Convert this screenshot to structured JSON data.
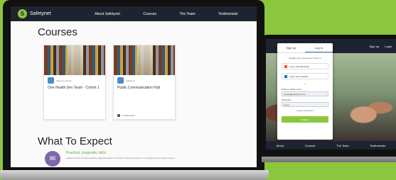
{
  "colors": {
    "background": "#8cc63f",
    "nav_bg": "#1d2330",
    "accent_green": "#8cc63f",
    "feature_purple": "#7b69a8",
    "link_blue": "#3a6fb0"
  },
  "laptop": {
    "nav": {
      "logo_text": "Safetynet",
      "links": [
        "About Safetynet",
        "Courses",
        "The Team",
        "Testimonials"
      ]
    },
    "courses_title": "Courses",
    "cards": [
      {
        "author": "Safetynet Admin",
        "title": "One Health Dev Team - Cohort 1",
        "footer": ""
      },
      {
        "author": "Safetynet",
        "title": "Public Communication Hub",
        "footer": "In Discussion"
      }
    ],
    "expect_title": "What To Expect",
    "feature": {
      "name": "Practical, pragmatic skills",
      "description": "Safetynet aims to build practical, pragmatic skills in the field of infection control, to be implemented locally. Courses..."
    }
  },
  "monitor": {
    "top_nav": [
      "Sign up",
      "Login"
    ],
    "footer_links": [
      "About",
      "Courses",
      "The Team",
      "Testimonials"
    ],
    "login": {
      "tabs": [
        "Sign Up",
        "Log In"
      ],
      "prompt": "Already have an account?",
      "prompt_link": "Sign up",
      "microsoft_button": "Log in with Microsoft",
      "linkedin_button": "Log in with LinkedIn",
      "or": "or",
      "email_label": "Email or public name",
      "email_value": "sophie@safetynet.com",
      "password_label": "Password",
      "password_value": "••••••••",
      "forgot": "Forgot password?",
      "login_button": "Log in"
    }
  }
}
